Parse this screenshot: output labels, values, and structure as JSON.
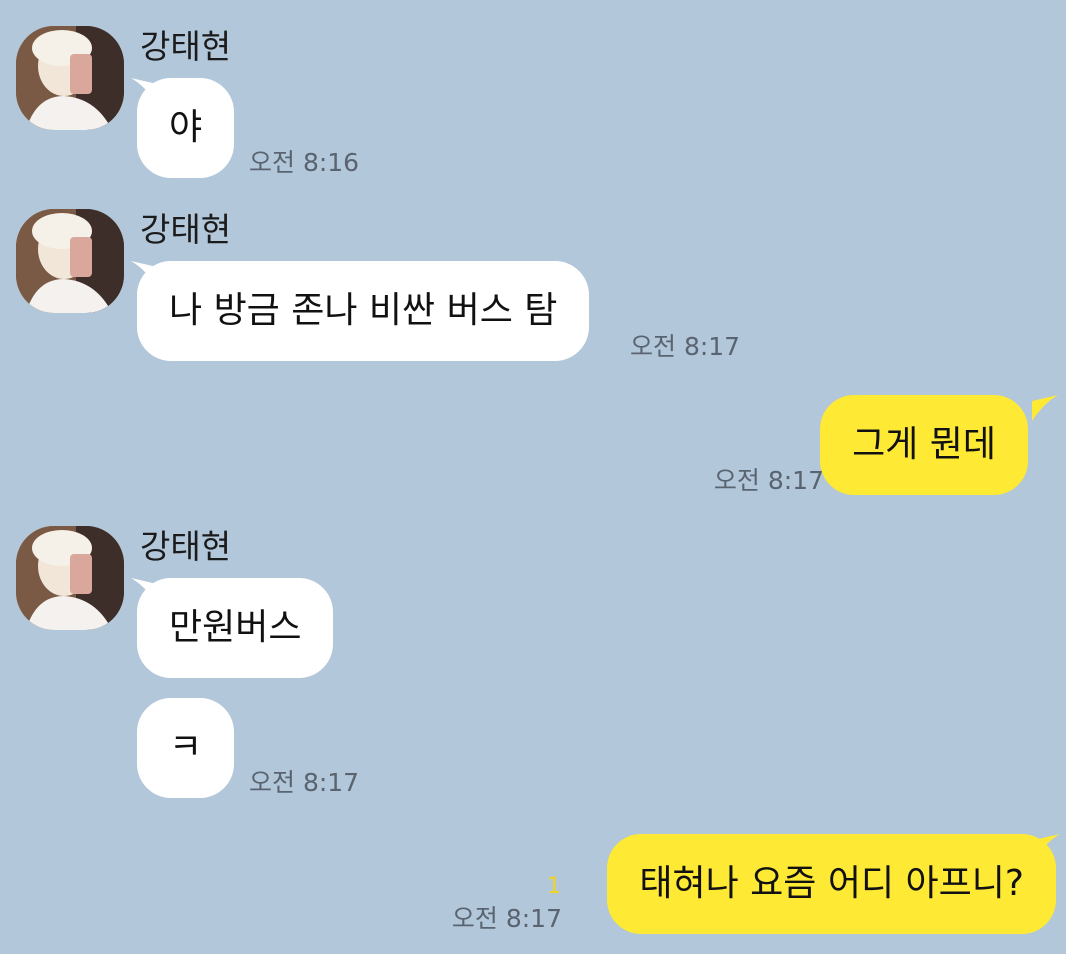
{
  "colors": {
    "background": "#b2c7da",
    "incoming_bubble": "#ffffff",
    "outgoing_bubble": "#fee934",
    "time_text": "#5a6470",
    "unread_count": "#f2d51a"
  },
  "messages": [
    {
      "direction": "in",
      "sender": "강태현",
      "text": "야",
      "time": "오전 8:16"
    },
    {
      "direction": "in",
      "sender": "강태현",
      "text": "나 방금 존나 비싼 버스 탐",
      "time": "오전 8:17"
    },
    {
      "direction": "out",
      "text": "그게 뭔데",
      "time": "오전 8:17"
    },
    {
      "direction": "in",
      "sender": "강태현",
      "text": "만원버스",
      "time": ""
    },
    {
      "direction": "in",
      "text": "ㅋ",
      "time": "오전 8:17"
    },
    {
      "direction": "out",
      "text": "태혀나 요즘 어디 아프니?",
      "time": "오전 8:17",
      "unread": "1"
    }
  ]
}
